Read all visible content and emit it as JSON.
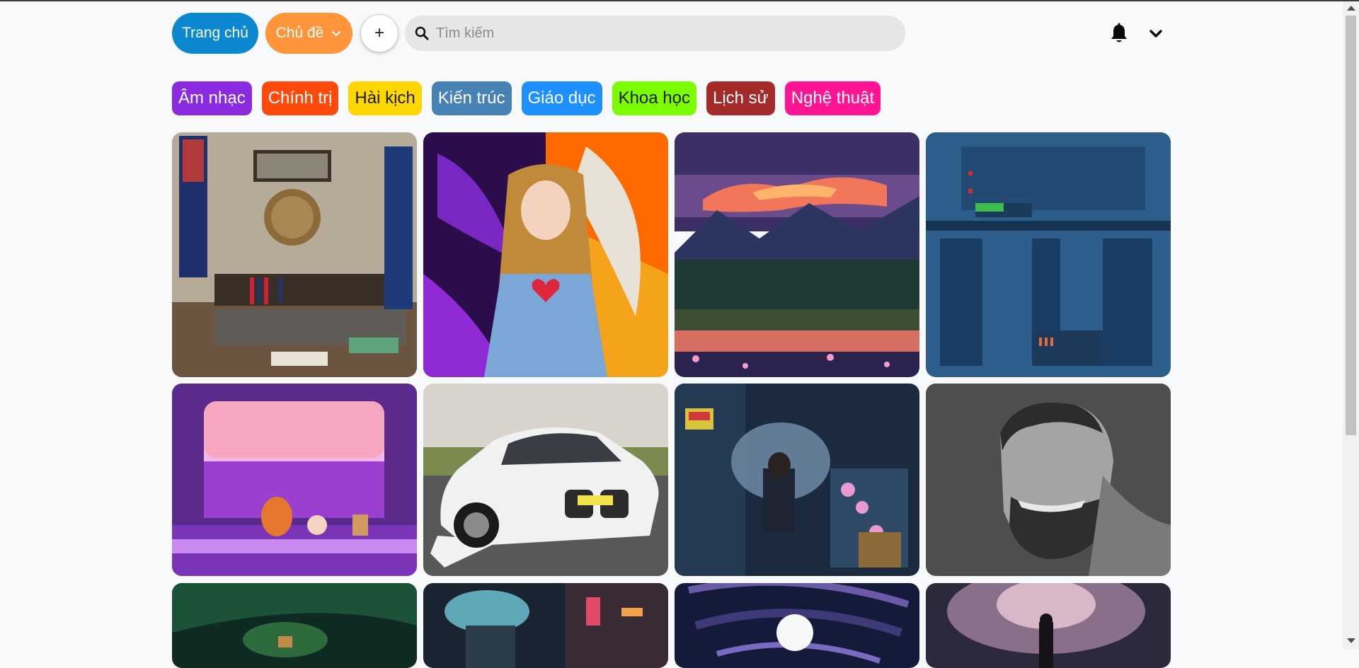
{
  "header": {
    "home_label": "Trang chủ",
    "topic_label": "Chủ đề",
    "add_symbol": "+",
    "search_placeholder": "Tìm kiếm",
    "home_color": "#0b88cf",
    "topic_color": "#ff953a"
  },
  "categories": [
    {
      "label": "Âm nhạc",
      "bg": "#8a2be2",
      "fg": "#ffffff"
    },
    {
      "label": "Chính trị",
      "bg": "#ff4a0c",
      "fg": "#ffffff"
    },
    {
      "label": "Hài kịch",
      "bg": "#ffd700",
      "fg": "#1a1a1a"
    },
    {
      "label": "Kiến trúc",
      "bg": "#4682b4",
      "fg": "#ffffff"
    },
    {
      "label": "Giáo dục",
      "bg": "#1e90ff",
      "fg": "#ffffff"
    },
    {
      "label": "Khoa học",
      "bg": "#7cfc00",
      "fg": "#1a1a1a"
    },
    {
      "label": "Lịch sử",
      "bg": "#a52a2a",
      "fg": "#ffffff"
    },
    {
      "label": "Nghệ thuật",
      "bg": "#ff1493",
      "fg": "#ffffff"
    }
  ],
  "gallery": [
    {
      "name": "office-desk"
    },
    {
      "name": "angel-demon-girl"
    },
    {
      "name": "pixel-sunset-lake"
    },
    {
      "name": "pixel-machinery"
    },
    {
      "name": "train-window-corgi"
    },
    {
      "name": "white-bmw-car"
    },
    {
      "name": "rainy-market-girl"
    },
    {
      "name": "bearded-man-portrait"
    },
    {
      "name": "forest-scene"
    },
    {
      "name": "cyberpunk-street"
    },
    {
      "name": "space-vortex"
    },
    {
      "name": "misty-figure"
    }
  ]
}
